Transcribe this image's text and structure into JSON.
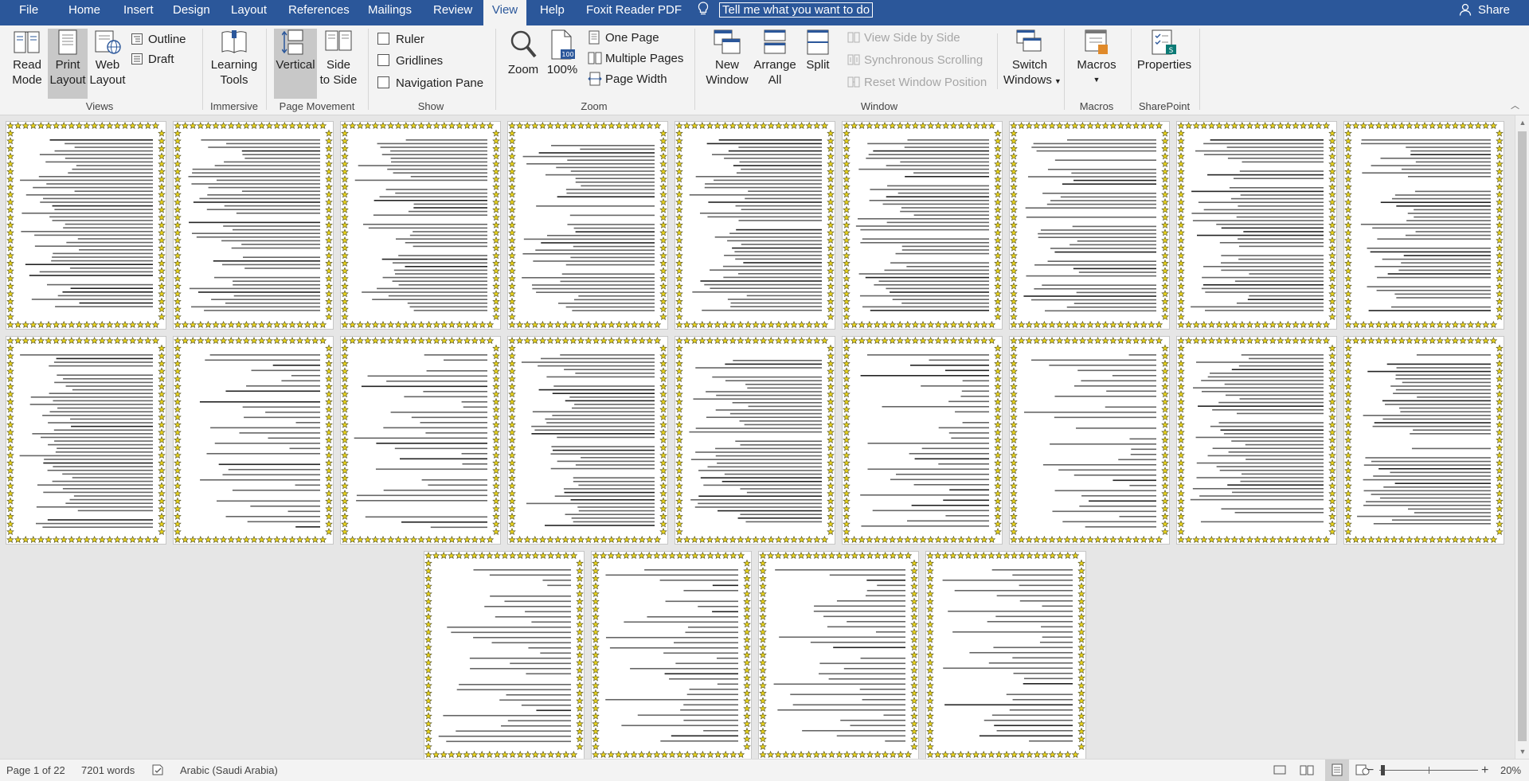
{
  "tabs": {
    "file": "File",
    "home": "Home",
    "insert": "Insert",
    "design": "Design",
    "layout": "Layout",
    "references": "References",
    "mailings": "Mailings",
    "review": "Review",
    "view": "View",
    "help": "Help",
    "foxit": "Foxit Reader PDF"
  },
  "tell_me": "Tell me what you want to do",
  "share": "Share",
  "ribbon": {
    "views": {
      "label": "Views",
      "read_mode_1": "Read",
      "read_mode_2": "Mode",
      "print_layout_1": "Print",
      "print_layout_2": "Layout",
      "web_layout_1": "Web",
      "web_layout_2": "Layout",
      "outline": "Outline",
      "draft": "Draft"
    },
    "immersive": {
      "label": "Immersive",
      "learning_1": "Learning",
      "learning_2": "Tools"
    },
    "page_movement": {
      "label": "Page Movement",
      "vertical": "Vertical",
      "side_1": "Side",
      "side_2": "to Side"
    },
    "show": {
      "label": "Show",
      "ruler": "Ruler",
      "gridlines": "Gridlines",
      "nav_pane": "Navigation Pane"
    },
    "zoom": {
      "label": "Zoom",
      "zoom": "Zoom",
      "hundred": "100%",
      "badge": "100",
      "one_page": "One Page",
      "multiple_pages": "Multiple Pages",
      "page_width": "Page Width"
    },
    "window": {
      "label": "Window",
      "new_window_1": "New",
      "new_window_2": "Window",
      "arrange_1": "Arrange",
      "arrange_2": "All",
      "split": "Split",
      "view_side": "View Side by Side",
      "sync_scroll": "Synchronous Scrolling",
      "reset_pos": "Reset Window Position",
      "switch_1": "Switch",
      "switch_2": "Windows"
    },
    "macros": {
      "label": "Macros",
      "macros": "Macros"
    },
    "sharepoint": {
      "label": "SharePoint",
      "properties": "Properties"
    }
  },
  "status": {
    "page": "Page 1 of 22",
    "words": "7201 words",
    "language": "Arabic (Saudi Arabia)",
    "zoom": "20%"
  },
  "colors": {
    "accent": "#2b579a",
    "star_fill": "#e8d21c",
    "star_stroke": "#4a4a20"
  },
  "icons": [
    "lightbulb-icon",
    "person-icon",
    "spelling-check-icon",
    "read-mode-icon",
    "print-layout-icon",
    "web-layout-icon",
    "focus-icon"
  ]
}
